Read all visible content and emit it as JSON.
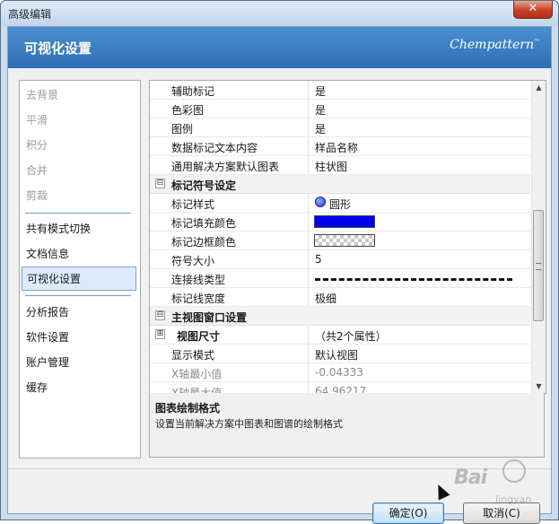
{
  "window": {
    "title": "高级编辑",
    "close_glyph": "✕"
  },
  "header": {
    "title": "可视化设置",
    "brand": "Chempattern",
    "brand_mark": "™"
  },
  "sidebar": {
    "items": [
      {
        "label": "去背景",
        "state": "disabled"
      },
      {
        "label": "平滑",
        "state": "disabled"
      },
      {
        "label": "积分",
        "state": "disabled"
      },
      {
        "label": "合并",
        "state": "disabled"
      },
      {
        "label": "剪裁",
        "state": "disabled"
      },
      {
        "label": "共有模式切换",
        "state": "normal"
      },
      {
        "label": "文档信息",
        "state": "normal"
      },
      {
        "label": "可视化设置",
        "state": "selected"
      },
      {
        "label": "分析报告",
        "state": "normal"
      },
      {
        "label": "软件设置",
        "state": "normal"
      },
      {
        "label": "账户管理",
        "state": "normal"
      },
      {
        "label": "缓存",
        "state": "normal"
      }
    ]
  },
  "properties": {
    "rows": [
      {
        "name": "辅助标记",
        "value": "是"
      },
      {
        "name": "色彩图",
        "value": "是"
      },
      {
        "name": "图例",
        "value": "是"
      },
      {
        "name": "数据标记文本内容",
        "value": "样品名称"
      },
      {
        "name": "通用解决方案默认图表",
        "value": "柱状图"
      }
    ],
    "category_marker": {
      "title": "标记符号设定",
      "toggle_glyph": "⊟",
      "marker_style": {
        "name": "标记样式",
        "value": "圆形",
        "color": "#2a3bd0"
      },
      "fill_color": {
        "name": "标记填充颜色",
        "color": "#0000ee"
      },
      "border_color": {
        "name": "标记边框颜色",
        "color": "transparent"
      },
      "symbol_size": {
        "name": "符号大小",
        "value": "5"
      },
      "line_type": {
        "name": "连接线类型",
        "value": "dashed"
      },
      "line_width": {
        "name": "标记线宽度",
        "value": "极细"
      }
    },
    "category_view": {
      "title": "主视图窗口设置",
      "toggle_glyph": "⊟",
      "view_size": {
        "name": "视图尺寸",
        "value": "（共2个属性）",
        "toggle_glyph": "⊞"
      },
      "display_mode": {
        "name": "显示模式",
        "value": "默认视图"
      },
      "x_min": {
        "name": "X轴最小值",
        "value": "-0.04333"
      },
      "x_max": {
        "name": "X轴最大值",
        "value": "64.96217"
      }
    }
  },
  "scrollbar": {
    "up_icon": "▲",
    "down_icon": "▼",
    "grip_icon": "≡"
  },
  "description": {
    "title": "图表绘制格式",
    "text": "设置当前解决方案中图表和图谱的绘制格式"
  },
  "buttons": {
    "ok": "确定(O)",
    "cancel": "取消(C)"
  },
  "watermark": {
    "brand": "Bai",
    "sub": "jingyan"
  }
}
